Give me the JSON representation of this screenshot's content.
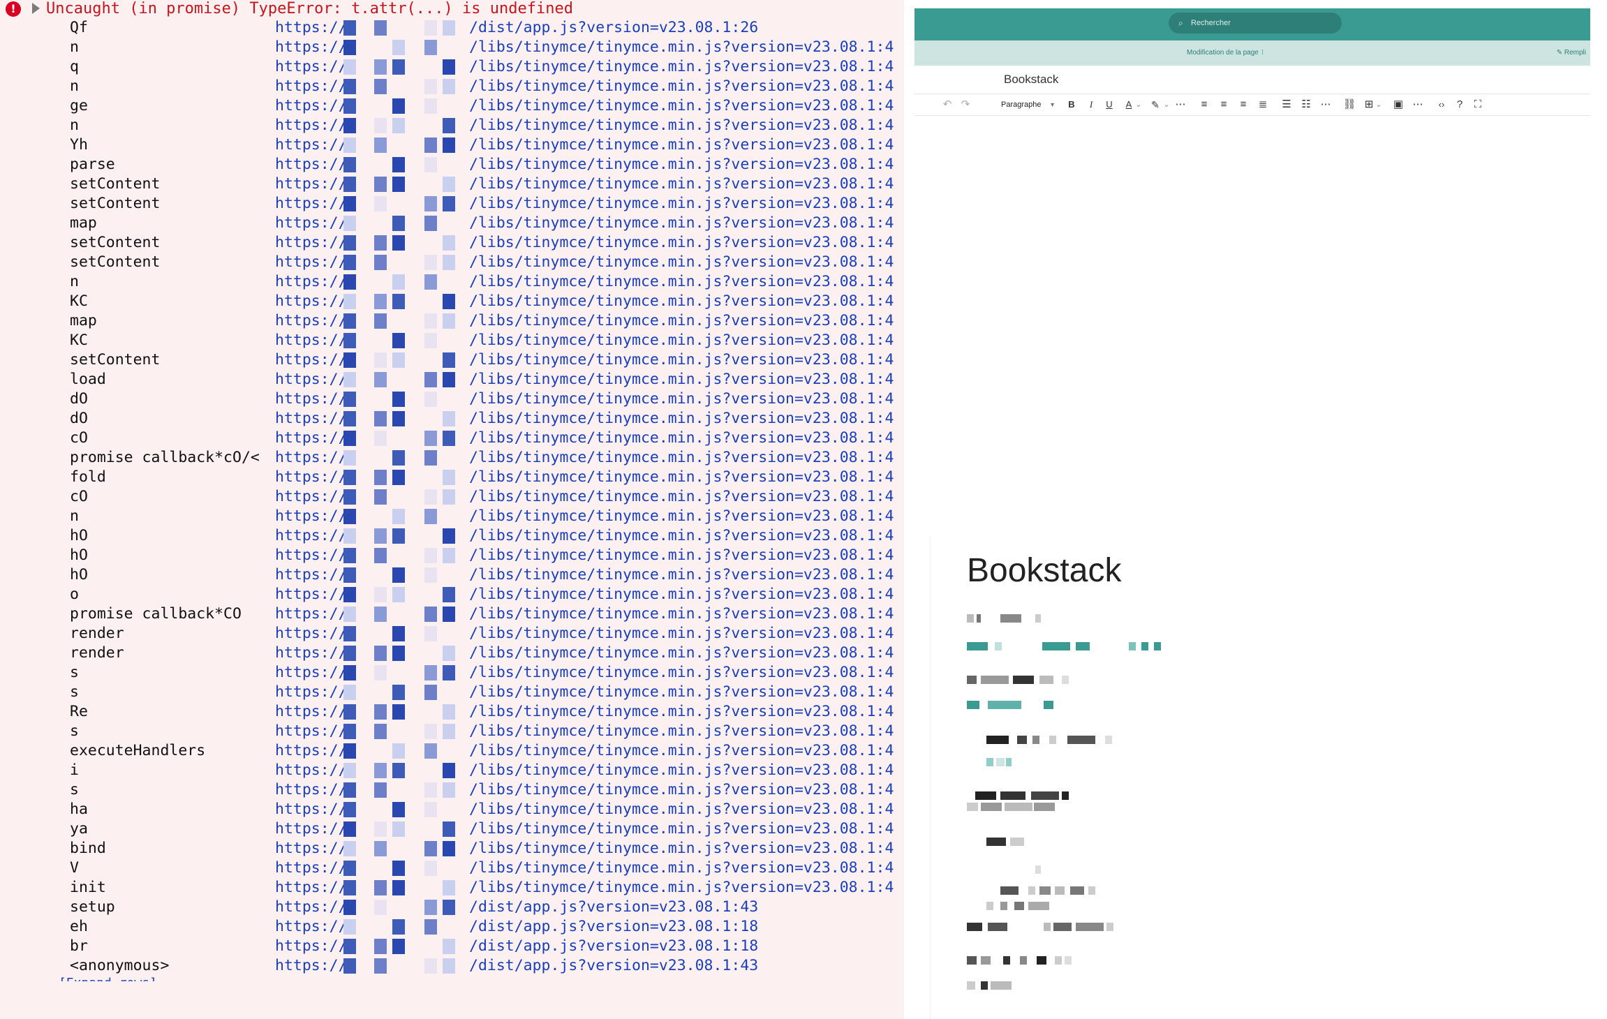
{
  "console": {
    "error_icon": "error-icon",
    "error_message": "Uncaught (in promise) TypeError: t.attr(...) is undefined",
    "more_frames_label": "[Expand rows]",
    "frames": [
      {
        "fn": "Qf",
        "host": "https://",
        "path": "/dist/app.js?version=v23.08.1:",
        "line": "26"
      },
      {
        "fn": "n",
        "host": "https://",
        "path": "/libs/tinymce/tinymce.min.js?version=v23.08.1:",
        "line": "4"
      },
      {
        "fn": "q",
        "host": "https://",
        "path": "/libs/tinymce/tinymce.min.js?version=v23.08.1:",
        "line": "4"
      },
      {
        "fn": "n",
        "host": "https://",
        "path": "/libs/tinymce/tinymce.min.js?version=v23.08.1:",
        "line": "4"
      },
      {
        "fn": "ge",
        "host": "https://",
        "path": "/libs/tinymce/tinymce.min.js?version=v23.08.1:",
        "line": "4"
      },
      {
        "fn": "n",
        "host": "https://",
        "path": "/libs/tinymce/tinymce.min.js?version=v23.08.1:",
        "line": "4"
      },
      {
        "fn": "Yh",
        "host": "https://",
        "path": "/libs/tinymce/tinymce.min.js?version=v23.08.1:",
        "line": "4"
      },
      {
        "fn": "parse",
        "host": "https://",
        "path": "/libs/tinymce/tinymce.min.js?version=v23.08.1:",
        "line": "4"
      },
      {
        "fn": "setContent",
        "host": "https://",
        "path": "/libs/tinymce/tinymce.min.js?version=v23.08.1:",
        "line": "4"
      },
      {
        "fn": "setContent",
        "host": "https://",
        "path": "/libs/tinymce/tinymce.min.js?version=v23.08.1:",
        "line": "4"
      },
      {
        "fn": "map",
        "host": "https://",
        "path": "/libs/tinymce/tinymce.min.js?version=v23.08.1:",
        "line": "4"
      },
      {
        "fn": "setContent",
        "host": "https://",
        "path": "/libs/tinymce/tinymce.min.js?version=v23.08.1:",
        "line": "4"
      },
      {
        "fn": "setContent",
        "host": "https://",
        "path": "/libs/tinymce/tinymce.min.js?version=v23.08.1:",
        "line": "4"
      },
      {
        "fn": "n",
        "host": "https://",
        "path": "/libs/tinymce/tinymce.min.js?version=v23.08.1:",
        "line": "4"
      },
      {
        "fn": "KC",
        "host": "https://",
        "path": "/libs/tinymce/tinymce.min.js?version=v23.08.1:",
        "line": "4"
      },
      {
        "fn": "map",
        "host": "https://",
        "path": "/libs/tinymce/tinymce.min.js?version=v23.08.1:",
        "line": "4"
      },
      {
        "fn": "KC",
        "host": "https://",
        "path": "/libs/tinymce/tinymce.min.js?version=v23.08.1:",
        "line": "4"
      },
      {
        "fn": "setContent",
        "host": "https://",
        "path": "/libs/tinymce/tinymce.min.js?version=v23.08.1:",
        "line": "4"
      },
      {
        "fn": "load",
        "host": "https://",
        "path": "/libs/tinymce/tinymce.min.js?version=v23.08.1:",
        "line": "4"
      },
      {
        "fn": "dO",
        "host": "https://",
        "path": "/libs/tinymce/tinymce.min.js?version=v23.08.1:",
        "line": "4"
      },
      {
        "fn": "dO",
        "host": "https://",
        "path": "/libs/tinymce/tinymce.min.js?version=v23.08.1:",
        "line": "4"
      },
      {
        "fn": "cO",
        "host": "https://",
        "path": "/libs/tinymce/tinymce.min.js?version=v23.08.1:",
        "line": "4"
      },
      {
        "fn": "promise callback*cO/<",
        "host": "https://",
        "path": "/libs/tinymce/tinymce.min.js?version=v23.08.1:",
        "line": "4"
      },
      {
        "fn": "fold",
        "host": "https://",
        "path": "/libs/tinymce/tinymce.min.js?version=v23.08.1:",
        "line": "4"
      },
      {
        "fn": "cO",
        "host": "https://",
        "path": "/libs/tinymce/tinymce.min.js?version=v23.08.1:",
        "line": "4"
      },
      {
        "fn": "n",
        "host": "https://",
        "path": "/libs/tinymce/tinymce.min.js?version=v23.08.1:",
        "line": "4"
      },
      {
        "fn": "hO",
        "host": "https://",
        "path": "/libs/tinymce/tinymce.min.js?version=v23.08.1:",
        "line": "4"
      },
      {
        "fn": "hO",
        "host": "https://",
        "path": "/libs/tinymce/tinymce.min.js?version=v23.08.1:",
        "line": "4"
      },
      {
        "fn": "hO",
        "host": "https://",
        "path": "/libs/tinymce/tinymce.min.js?version=v23.08.1:",
        "line": "4"
      },
      {
        "fn": "o",
        "host": "https://",
        "path": "/libs/tinymce/tinymce.min.js?version=v23.08.1:",
        "line": "4"
      },
      {
        "fn": "promise callback*CO",
        "host": "https://",
        "path": "/libs/tinymce/tinymce.min.js?version=v23.08.1:",
        "line": "4"
      },
      {
        "fn": "render",
        "host": "https://",
        "path": "/libs/tinymce/tinymce.min.js?version=v23.08.1:",
        "line": "4"
      },
      {
        "fn": "render",
        "host": "https://",
        "path": "/libs/tinymce/tinymce.min.js?version=v23.08.1:",
        "line": "4"
      },
      {
        "fn": "s",
        "host": "https://",
        "path": "/libs/tinymce/tinymce.min.js?version=v23.08.1:",
        "line": "4"
      },
      {
        "fn": "s",
        "host": "https://",
        "path": "/libs/tinymce/tinymce.min.js?version=v23.08.1:",
        "line": "4"
      },
      {
        "fn": "Re",
        "host": "https://",
        "path": "/libs/tinymce/tinymce.min.js?version=v23.08.1:",
        "line": "4"
      },
      {
        "fn": "s",
        "host": "https://",
        "path": "/libs/tinymce/tinymce.min.js?version=v23.08.1:",
        "line": "4"
      },
      {
        "fn": "executeHandlers",
        "host": "https://",
        "path": "/libs/tinymce/tinymce.min.js?version=v23.08.1:",
        "line": "4"
      },
      {
        "fn": "i",
        "host": "https://",
        "path": "/libs/tinymce/tinymce.min.js?version=v23.08.1:",
        "line": "4"
      },
      {
        "fn": "s",
        "host": "https://",
        "path": "/libs/tinymce/tinymce.min.js?version=v23.08.1:",
        "line": "4"
      },
      {
        "fn": "ha",
        "host": "https://",
        "path": "/libs/tinymce/tinymce.min.js?version=v23.08.1:",
        "line": "4"
      },
      {
        "fn": "ya",
        "host": "https://",
        "path": "/libs/tinymce/tinymce.min.js?version=v23.08.1:",
        "line": "4"
      },
      {
        "fn": "bind",
        "host": "https://",
        "path": "/libs/tinymce/tinymce.min.js?version=v23.08.1:",
        "line": "4"
      },
      {
        "fn": "V",
        "host": "https://",
        "path": "/libs/tinymce/tinymce.min.js?version=v23.08.1:",
        "line": "4"
      },
      {
        "fn": "init",
        "host": "https://",
        "path": "/libs/tinymce/tinymce.min.js?version=v23.08.1:",
        "line": "4"
      },
      {
        "fn": "setup",
        "host": "https://",
        "path": "/dist/app.js?version=v23.08.1:",
        "line": "43"
      },
      {
        "fn": "eh",
        "host": "https://",
        "path": "/dist/app.js?version=v23.08.1:",
        "line": "18"
      },
      {
        "fn": "br",
        "host": "https://",
        "path": "/dist/app.js?version=v23.08.1:",
        "line": "18"
      },
      {
        "fn": "<anonymous>",
        "host": "https://",
        "path": "/dist/app.js?version=v23.08.1:",
        "line": "43"
      }
    ]
  },
  "editor": {
    "search_placeholder": "Rechercher",
    "mode_label": "Modification de la page",
    "mode_toggle": "⁝",
    "fill_label": "✎ Rempli",
    "page_name": "Bookstack",
    "block_format": "Paragraphe",
    "colors": {
      "primary": "#3a9b93",
      "subbar": "#cde4e1"
    }
  },
  "preview": {
    "title": "Bookstack"
  }
}
